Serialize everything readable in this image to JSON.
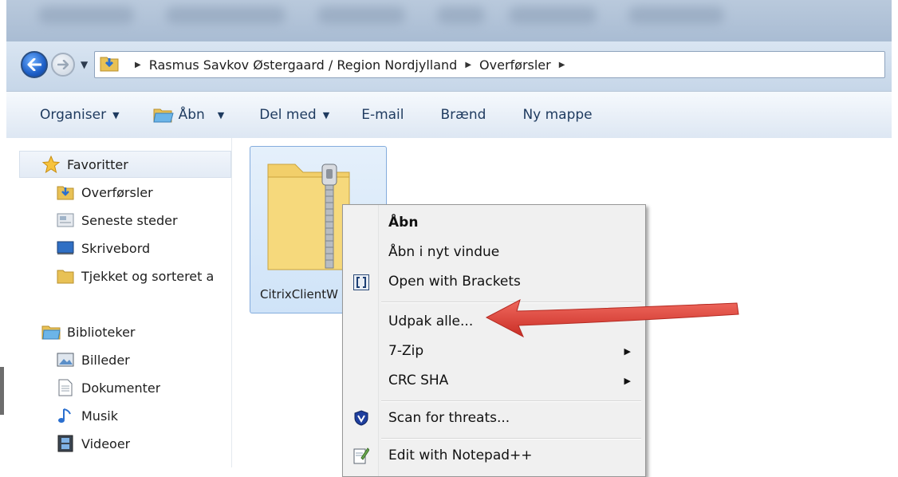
{
  "breadcrumb": {
    "items": [
      "Rasmus Savkov Østergaard / Region Nordjylland",
      "Overførsler"
    ]
  },
  "toolbar": {
    "organise": "Organiser",
    "open": "Åbn",
    "share": "Del med",
    "email": "E-mail",
    "burn": "Brænd",
    "new_folder": "Ny mappe"
  },
  "sidebar": {
    "favorites": "Favoritter",
    "fav_items": [
      "Overførsler",
      "Seneste steder",
      "Skrivebord",
      "Tjekket og sorteret a"
    ],
    "libraries": "Biblioteker",
    "lib_items": [
      "Billeder",
      "Dokumenter",
      "Musik",
      "Videoer"
    ]
  },
  "file": {
    "name": "CitrixClientW"
  },
  "context_menu": {
    "open": "Åbn",
    "open_new_window": "Åbn i nyt vindue",
    "open_brackets": "Open with Brackets",
    "extract_all": "Udpak alle...",
    "seven_zip": "7-Zip",
    "crc_sha": "CRC SHA",
    "scan": "Scan for threats...",
    "notepad": "Edit with Notepad++"
  },
  "colors": {
    "annotation_arrow": "#e0403a",
    "selection": "#cfe3f8"
  }
}
